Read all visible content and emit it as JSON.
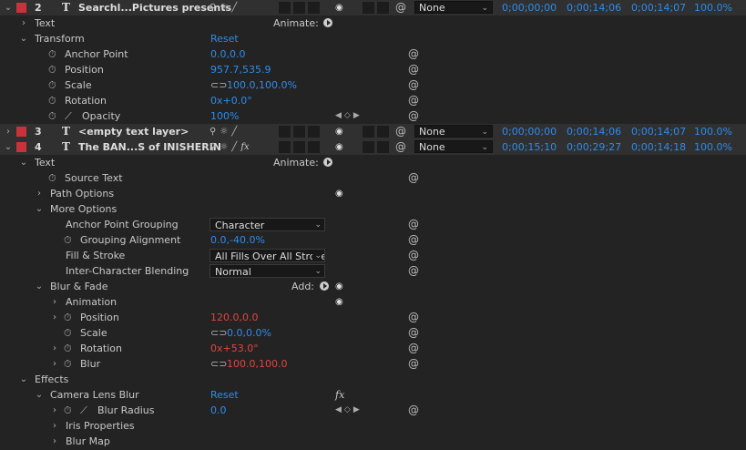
{
  "layers": {
    "l2": {
      "num": "2",
      "name": "Searchl...Pictures presents",
      "parent": "None",
      "in": "0;00;00;00",
      "out": "0;00;14;06",
      "dur": "0;00;14;07",
      "stretch": "100.0%"
    },
    "l3": {
      "num": "3",
      "name": "<empty text layer>",
      "parent": "None",
      "in": "0;00;00;00",
      "out": "0;00;14;06",
      "dur": "0;00;14;07",
      "stretch": "100.0%"
    },
    "l4": {
      "num": "4",
      "name": "The BAN...S of INISHERIN",
      "parent": "None",
      "in": "0;00;15;10",
      "out": "0;00;29;27",
      "dur": "0;00;14;18",
      "stretch": "100.0%"
    }
  },
  "labels": {
    "text": "Text",
    "animate": "Animate:",
    "transform": "Transform",
    "reset": "Reset",
    "anchor_point": "Anchor Point",
    "position": "Position",
    "scale": "Scale",
    "rotation": "Rotation",
    "opacity": "Opacity",
    "source_text": "Source Text",
    "path_options": "Path Options",
    "more_options": "More Options",
    "anchor_point_grouping": "Anchor Point Grouping",
    "grouping_alignment": "Grouping Alignment",
    "fill_stroke": "Fill & Stroke",
    "inter_char_blending": "Inter-Character Blending",
    "blur_fade": "Blur & Fade",
    "add": "Add:",
    "animation": "Animation",
    "blur": "Blur",
    "effects": "Effects",
    "camera_lens_blur": "Camera Lens Blur",
    "blur_radius": "Blur Radius",
    "iris_properties": "Iris Properties",
    "blur_map": "Blur Map",
    "fx": "fx"
  },
  "values": {
    "anchor_point": "0.0,0.0",
    "position": "957.7,535.9",
    "scale": "100.0,100.0%",
    "rotation": "0x+0.0°",
    "opacity": "100%",
    "anchor_grouping": "Character",
    "grouping_alignment": "0.0,-40.0%",
    "fill_stroke": "All Fills Over All Strokes",
    "inter_char_blending": "Normal",
    "bf_position": "120.0,0.0",
    "bf_scale": "0.0,0.0%",
    "bf_rotation": "0x+53.0°",
    "bf_blur": "100.0,100.0",
    "blur_radius": "0.0"
  },
  "colors": {
    "label_red": "#c8333b",
    "value_blue": "#2d8ceb",
    "value_red": "#e0463c",
    "bg": "#232323"
  }
}
